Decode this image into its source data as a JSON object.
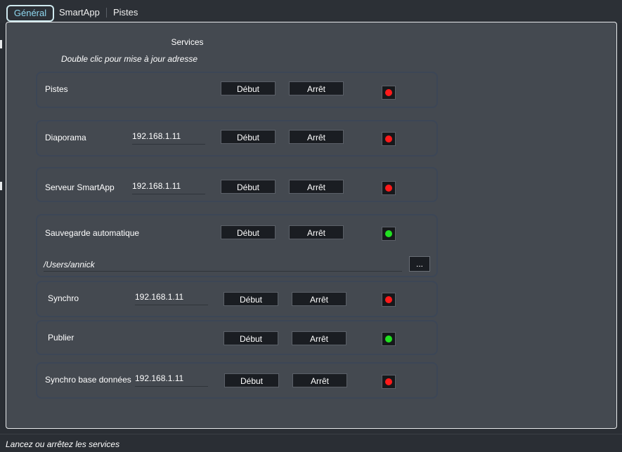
{
  "tabs": [
    {
      "label": "Général",
      "active": true
    },
    {
      "label": "SmartApp",
      "active": false
    },
    {
      "label": "Pistes",
      "active": false
    }
  ],
  "services": {
    "title": "Services",
    "hint": "Double clic pour mise à jour adresse"
  },
  "buttons": {
    "start": "Début",
    "stop": "Arrêt",
    "browse": "..."
  },
  "rows": {
    "pistes": {
      "label": "Pistes",
      "status": "stopped"
    },
    "diaporama": {
      "label": "Diaporama",
      "ip": "192.168.1.11",
      "status": "stopped"
    },
    "smartapp": {
      "label": "Serveur SmartApp",
      "ip": "192.168.1.11",
      "status": "stopped"
    },
    "autosave": {
      "label": "Sauvegarde automatique",
      "path": "/Users/annick",
      "status": "running"
    },
    "synchro": {
      "label": "Synchro",
      "ip": "192.168.1.11",
      "status": "stopped"
    },
    "publier": {
      "label": "Publier",
      "status": "running"
    },
    "dbsync": {
      "label": "Synchro base données",
      "ip": "192.168.1.11",
      "status": "stopped"
    }
  },
  "colors": {
    "running": "#21e021",
    "stopped": "#ff1a1a",
    "accent": "#8fd8f0"
  },
  "status_bar": "Lancez ou arrêtez les services"
}
